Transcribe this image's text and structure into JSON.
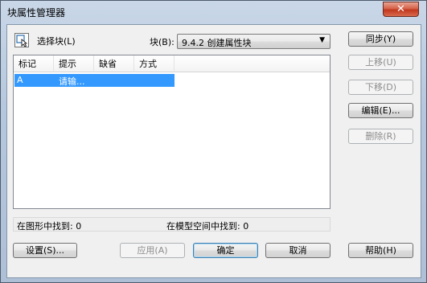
{
  "window": {
    "title": "块属性管理器",
    "close_glyph": "✕"
  },
  "select_block": {
    "label": "选择块(L)"
  },
  "block_field": {
    "label": "块(B):",
    "value": "9.4.2 创建属性块"
  },
  "list": {
    "columns": [
      "标记",
      "提示",
      "缺省",
      "方式"
    ],
    "rows": [
      {
        "tag": "A",
        "prompt": "请输...",
        "default": "",
        "mode": ""
      }
    ]
  },
  "side_buttons": {
    "sync": "同步(Y)",
    "move_up": "上移(U)",
    "move_down": "下移(D)",
    "edit": "编辑(E)...",
    "delete": "删除(R)"
  },
  "status": {
    "found_in_drawing": "在图形中找到: 0",
    "found_in_modelspace": "在模型空间中找到: 0"
  },
  "bottom_buttons": {
    "settings": "设置(S)...",
    "apply": "应用(A)",
    "ok": "确定",
    "cancel": "取消",
    "help": "帮助(H)"
  }
}
